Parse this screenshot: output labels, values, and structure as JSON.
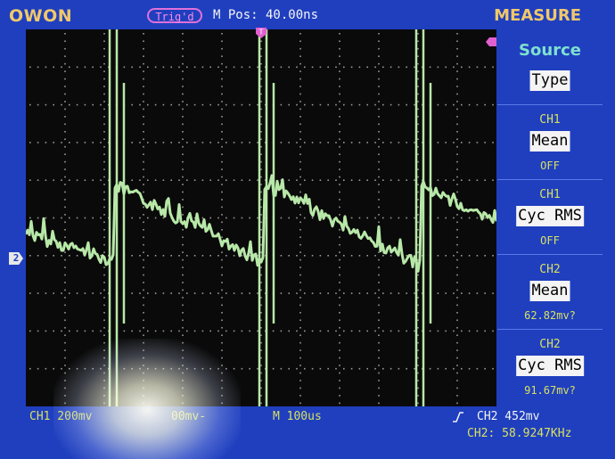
{
  "header": {
    "brand": "OWON",
    "trigger_status": "Trig'd",
    "m_pos": "M Pos: 40.00ns",
    "menu_title": "MEASURE"
  },
  "markers": {
    "ch2_ground": "2"
  },
  "measure_panel": {
    "source_title": "Source",
    "type_label": "Type",
    "items": [
      {
        "source": "CH1",
        "label": "Mean",
        "value": "OFF"
      },
      {
        "source": "CH1",
        "label": "Cyc RMS",
        "value": "OFF"
      },
      {
        "source": "CH2",
        "label": "Mean",
        "value": "62.82mv?"
      },
      {
        "source": "CH2",
        "label": "Cyc RMS",
        "value": "91.67mv?"
      }
    ]
  },
  "footer": {
    "ch1_scale": "CH1 200mv",
    "ch2_scale": "00mv-",
    "time_base": "M 100us",
    "trigger": "CH2 452mv",
    "frequency": "CH2: 58.9247KHz"
  },
  "colors": {
    "frame": "#1f3fbf",
    "trace": "#b8e8a8",
    "grid_dots": "#9a9a9a",
    "menu_text": "#f0c86a"
  }
}
